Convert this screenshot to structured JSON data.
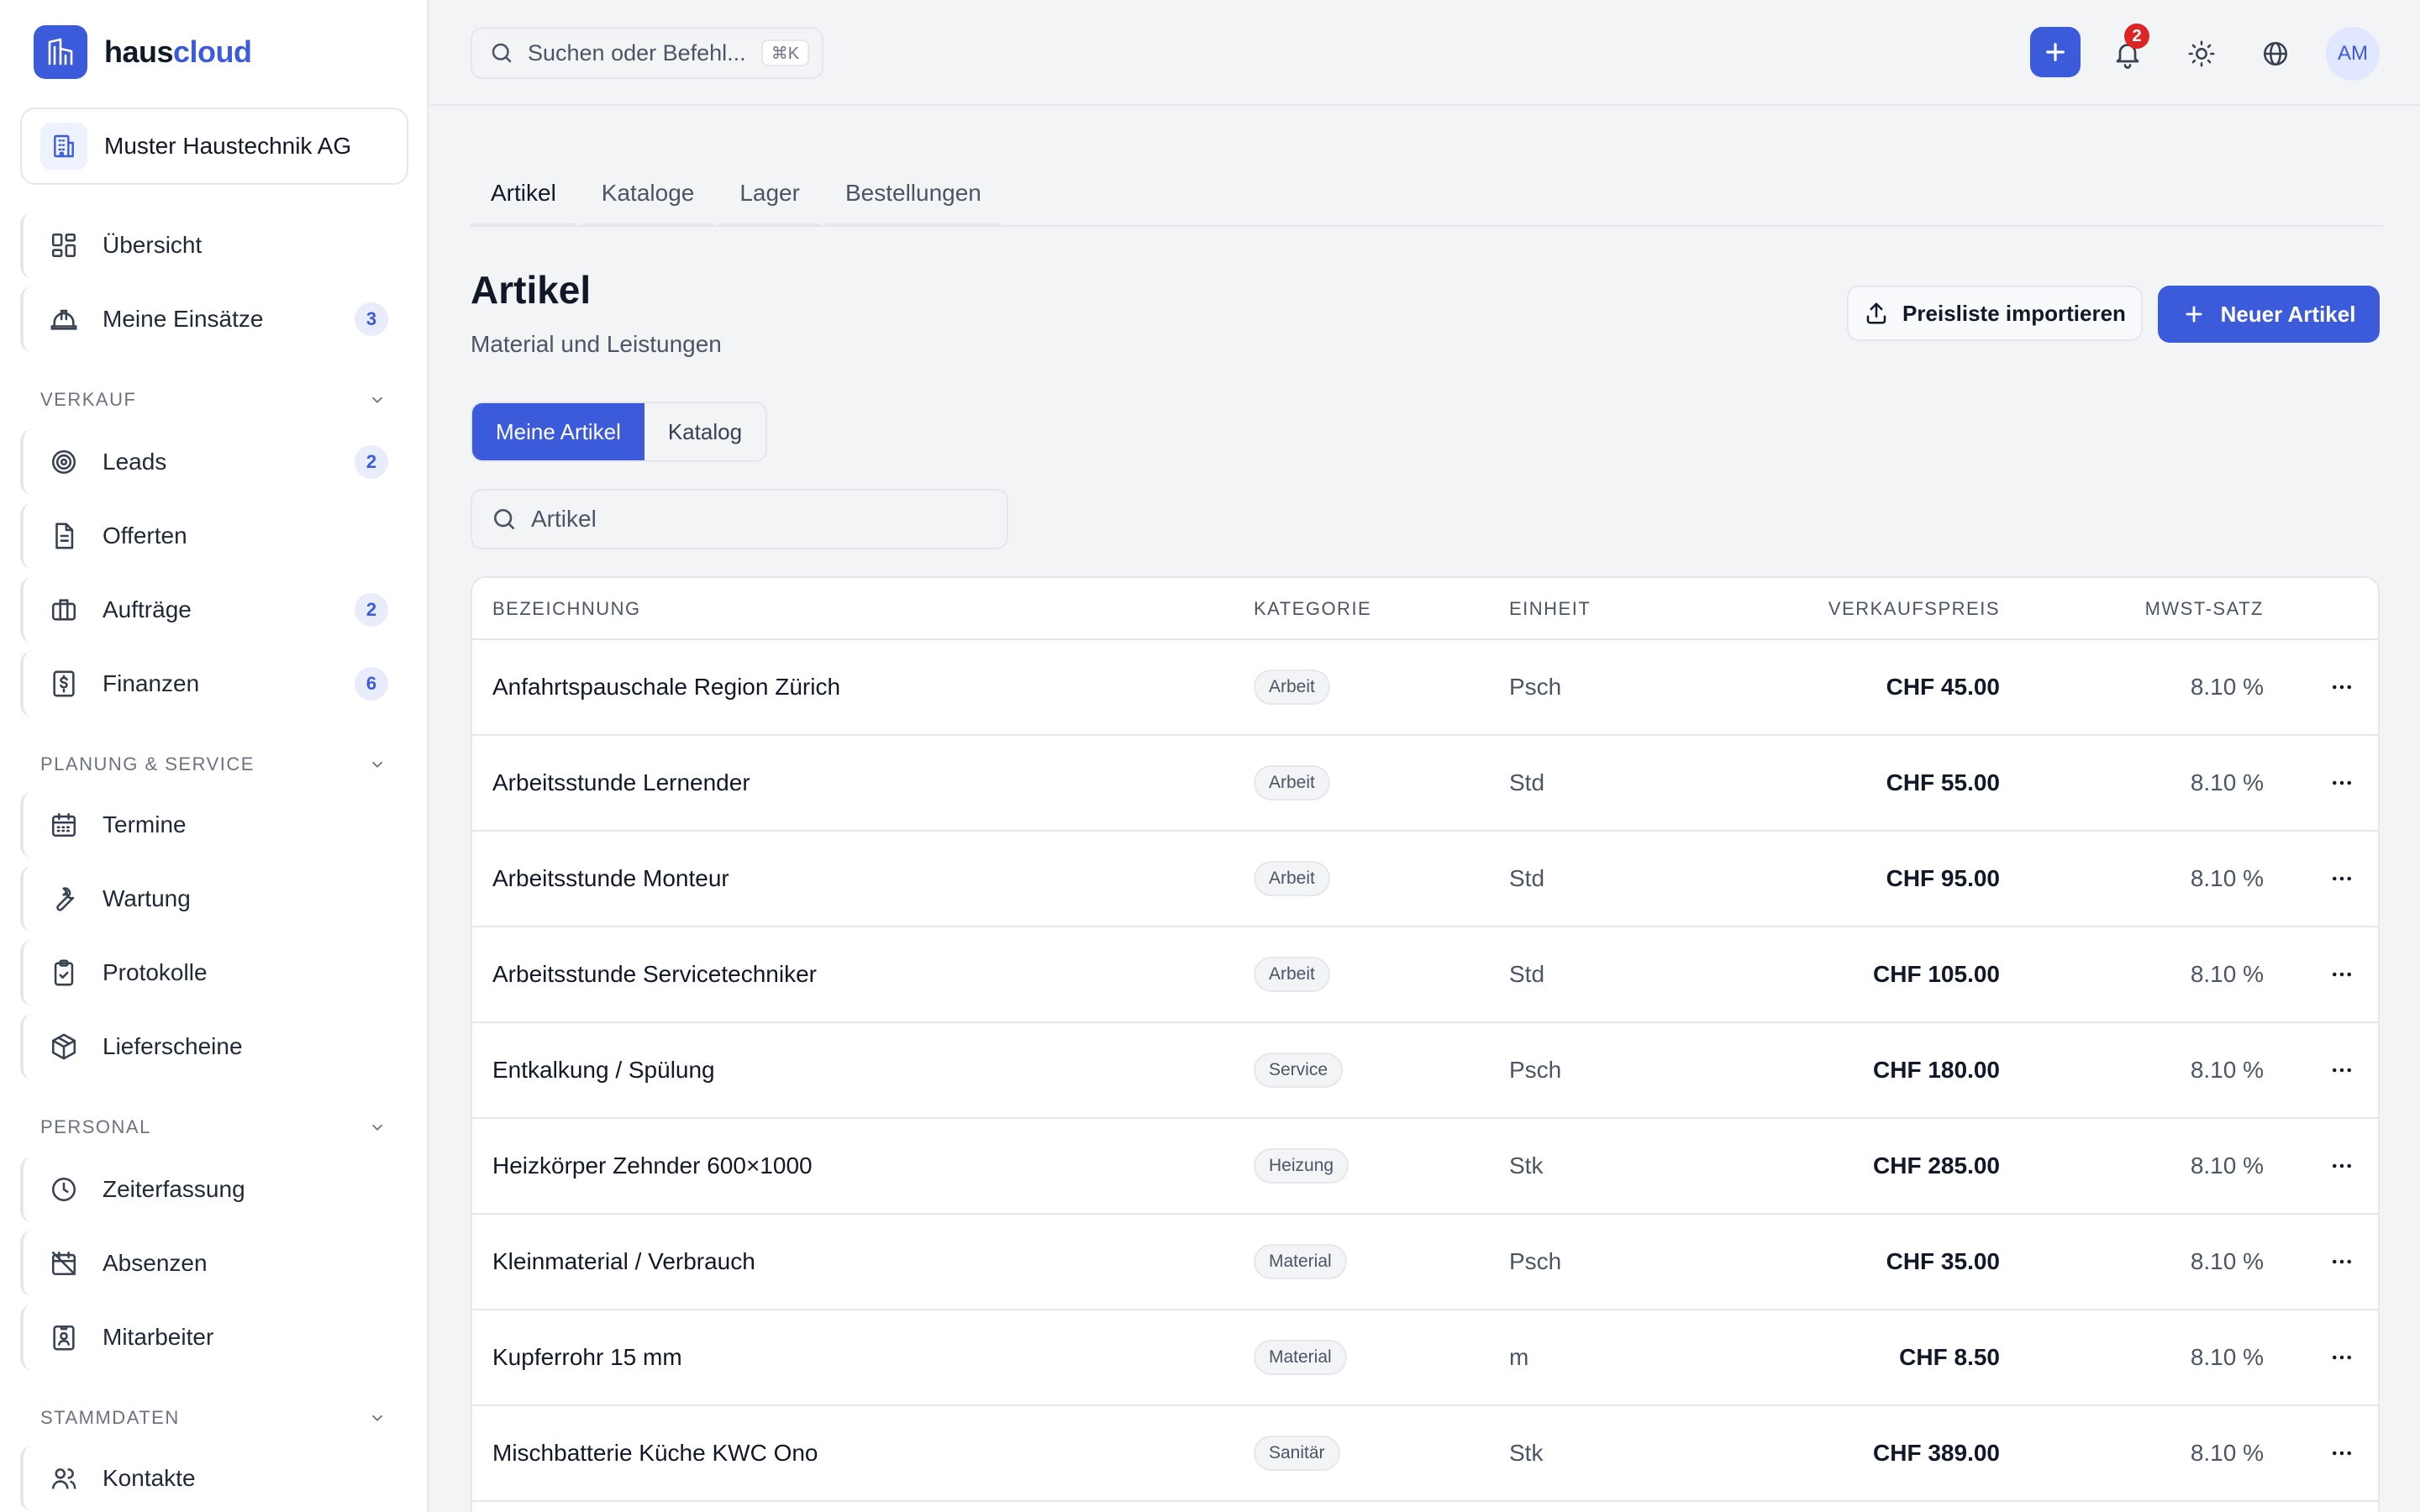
{
  "app": {
    "brand_a": "haus",
    "brand_b": "cloud",
    "company": "Muster Haustechnik AG"
  },
  "sidebar": {
    "top_items": [
      {
        "label": "Übersicht",
        "icon": "dashboard-icon"
      },
      {
        "label": "Meine Einsätze",
        "icon": "hardhat-icon",
        "badge": "3"
      }
    ],
    "sections": [
      {
        "title": "VERKAUF",
        "items": [
          {
            "label": "Leads",
            "icon": "target-icon",
            "badge": "2"
          },
          {
            "label": "Offerten",
            "icon": "document-icon"
          },
          {
            "label": "Aufträge",
            "icon": "briefcase-icon",
            "badge": "2"
          },
          {
            "label": "Finanzen",
            "icon": "dollar-receipt-icon",
            "badge": "6"
          }
        ]
      },
      {
        "title": "PLANUNG & SERVICE",
        "items": [
          {
            "label": "Termine",
            "icon": "calendar-icon"
          },
          {
            "label": "Wartung",
            "icon": "wrench-icon"
          },
          {
            "label": "Protokolle",
            "icon": "clipboard-check-icon"
          },
          {
            "label": "Lieferscheine",
            "icon": "package-icon"
          }
        ]
      },
      {
        "title": "PERSONAL",
        "items": [
          {
            "label": "Zeiterfassung",
            "icon": "clock-icon"
          },
          {
            "label": "Absenzen",
            "icon": "calendar-off-icon"
          },
          {
            "label": "Mitarbeiter",
            "icon": "id-badge-icon"
          }
        ]
      },
      {
        "title": "STAMMDATEN",
        "items": [
          {
            "label": "Kontakte",
            "icon": "users-icon"
          }
        ]
      }
    ]
  },
  "topbar": {
    "search_placeholder": "Suchen oder Befehl...",
    "shortcut": "⌘K",
    "notifications_count": "2",
    "avatar_initials": "AM"
  },
  "tabs": [
    "Artikel",
    "Kataloge",
    "Lager",
    "Bestellungen"
  ],
  "page": {
    "title": "Artikel",
    "subtitle": "Material und Leistungen",
    "import_label": "Preisliste importieren",
    "new_label": "Neuer Artikel",
    "segments": [
      "Meine Artikel",
      "Katalog"
    ],
    "search_placeholder": "Artikel"
  },
  "table": {
    "headers": {
      "name": "BEZEICHNUNG",
      "category": "KATEGORIE",
      "unit": "EINHEIT",
      "price": "VERKAUFSPREIS",
      "vat": "MWST-SATZ"
    },
    "rows": [
      {
        "name": "Anfahrtspauschale Region Zürich",
        "category": "Arbeit",
        "unit": "Psch",
        "price": "CHF 45.00",
        "vat": "8.10 %"
      },
      {
        "name": "Arbeitsstunde Lernender",
        "category": "Arbeit",
        "unit": "Std",
        "price": "CHF 55.00",
        "vat": "8.10 %"
      },
      {
        "name": "Arbeitsstunde Monteur",
        "category": "Arbeit",
        "unit": "Std",
        "price": "CHF 95.00",
        "vat": "8.10 %"
      },
      {
        "name": "Arbeitsstunde Servicetechniker",
        "category": "Arbeit",
        "unit": "Std",
        "price": "CHF 105.00",
        "vat": "8.10 %"
      },
      {
        "name": "Entkalkung / Spülung",
        "category": "Service",
        "unit": "Psch",
        "price": "CHF 180.00",
        "vat": "8.10 %"
      },
      {
        "name": "Heizkörper Zehnder 600×1000",
        "category": "Heizung",
        "unit": "Stk",
        "price": "CHF 285.00",
        "vat": "8.10 %"
      },
      {
        "name": "Kleinmaterial / Verbrauch",
        "category": "Material",
        "unit": "Psch",
        "price": "CHF 35.00",
        "vat": "8.10 %"
      },
      {
        "name": "Kupferrohr 15 mm",
        "category": "Material",
        "unit": "m",
        "price": "CHF 8.50",
        "vat": "8.10 %"
      },
      {
        "name": "Mischbatterie Küche KWC Ono",
        "category": "Sanitär",
        "unit": "Stk",
        "price": "CHF 389.00",
        "vat": "8.10 %"
      }
    ]
  },
  "colors": {
    "accent": "#3b5bdb",
    "badge_bg": "#e8ecfb",
    "notification": "#dc2626",
    "background": "#f3f4f6",
    "border": "#e5e7eb"
  }
}
